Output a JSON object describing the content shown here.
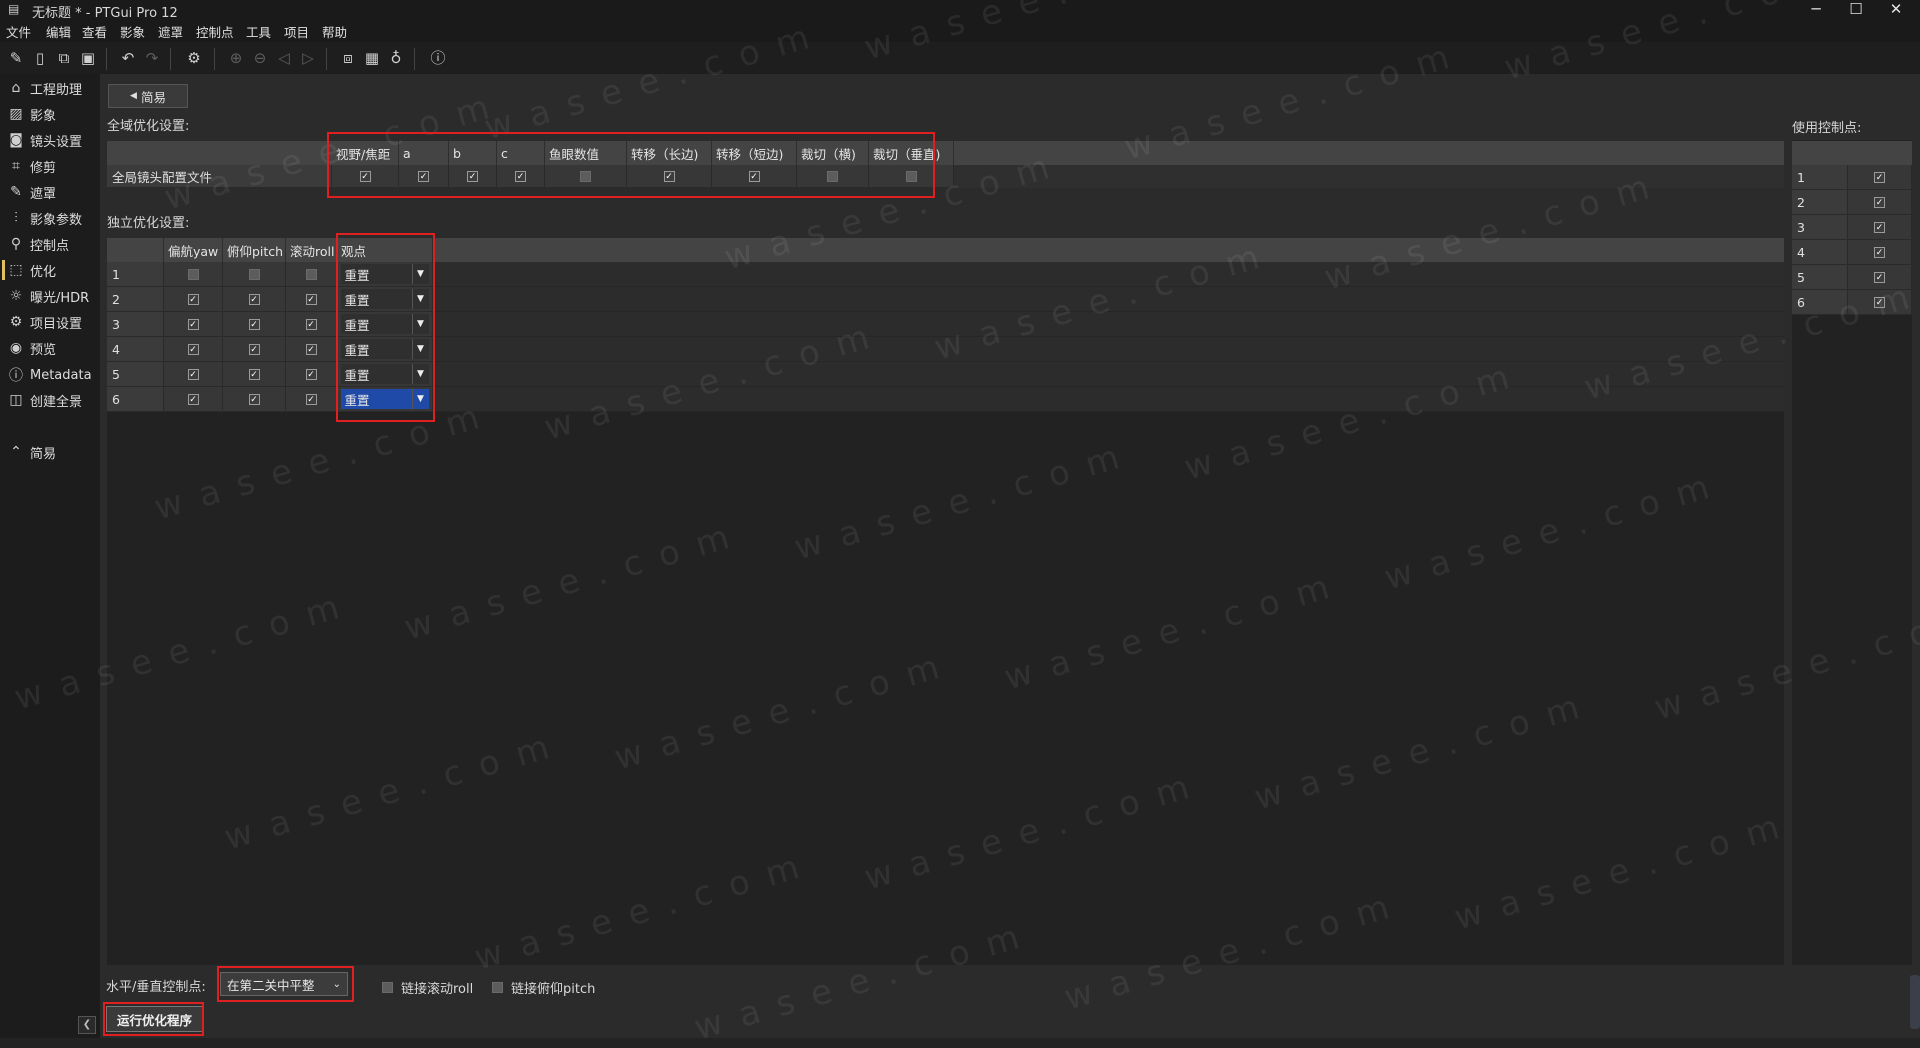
{
  "window": {
    "title": "无标题 * - PTGui Pro 12",
    "min": "─",
    "max": "☐",
    "close": "✕"
  },
  "menu": [
    "文件",
    "编辑",
    "查看",
    "影象",
    "遮罩",
    "控制点",
    "工具",
    "项目",
    "帮助"
  ],
  "sidebar": {
    "items": [
      {
        "label": "工程助理",
        "icon": "⌂"
      },
      {
        "label": "影象",
        "icon": "▨"
      },
      {
        "label": "镜头设置",
        "icon": "◙"
      },
      {
        "label": "修剪",
        "icon": "⌗"
      },
      {
        "label": "遮罩",
        "icon": "✎"
      },
      {
        "label": "影象参数",
        "icon": "⫶"
      },
      {
        "label": "控制点",
        "icon": "⚲"
      },
      {
        "label": "优化",
        "icon": "⬚"
      },
      {
        "label": "曝光/HDR",
        "icon": "☼"
      },
      {
        "label": "项目设置",
        "icon": "⚙"
      },
      {
        "label": "预览",
        "icon": "◉"
      },
      {
        "label": "Metadata",
        "icon": "ⓘ"
      },
      {
        "label": "创建全景",
        "icon": "◫"
      }
    ],
    "simple": {
      "label": "简易",
      "icon": "⌃"
    },
    "collapse_icon": "❮"
  },
  "main": {
    "simple_button": "简易",
    "global_label": "全域优化设置:",
    "global_table": {
      "headers": [
        "视野/焦距",
        "a",
        "b",
        "c",
        "鱼眼数值",
        "转移（长边)",
        "转移（短边)",
        "裁切（横)",
        "裁切（垂直)"
      ],
      "row_label": "全局镜头配置文件",
      "values": [
        true,
        true,
        true,
        true,
        false,
        true,
        true,
        false,
        false
      ]
    },
    "individual_label": "独立优化设置:",
    "individual_table": {
      "headers": [
        "偏航yaw",
        "俯仰pitch",
        "滚动roll",
        "观点"
      ],
      "rows": [
        {
          "id": "1",
          "yaw": false,
          "pitch": false,
          "roll": false,
          "viewpoint": "重置",
          "selected": false
        },
        {
          "id": "2",
          "yaw": true,
          "pitch": true,
          "roll": true,
          "viewpoint": "重置",
          "selected": false
        },
        {
          "id": "3",
          "yaw": true,
          "pitch": true,
          "roll": true,
          "viewpoint": "重置",
          "selected": false
        },
        {
          "id": "4",
          "yaw": true,
          "pitch": true,
          "roll": true,
          "viewpoint": "重置",
          "selected": false
        },
        {
          "id": "5",
          "yaw": true,
          "pitch": true,
          "roll": true,
          "viewpoint": "重置",
          "selected": false
        },
        {
          "id": "6",
          "yaw": true,
          "pitch": true,
          "roll": true,
          "viewpoint": "重置",
          "selected": true
        }
      ]
    },
    "use_cp_label": "使用控制点:",
    "use_cp_rows": [
      {
        "id": "1",
        "on": true
      },
      {
        "id": "2",
        "on": true
      },
      {
        "id": "3",
        "on": true
      },
      {
        "id": "4",
        "on": true
      },
      {
        "id": "5",
        "on": true
      },
      {
        "id": "6",
        "on": true
      }
    ],
    "hv_label": "水平/垂直控制点:",
    "hv_value": "在第二关中平整",
    "link_roll": "链接滚动roll",
    "link_pitch": "链接俯仰pitch",
    "run_button": "运行优化程序"
  },
  "watermark": "wasee.com",
  "colors": {
    "accent_red": "#e02020",
    "selected_blue": "#1f4aa8",
    "active_bar": "#e0c060"
  }
}
